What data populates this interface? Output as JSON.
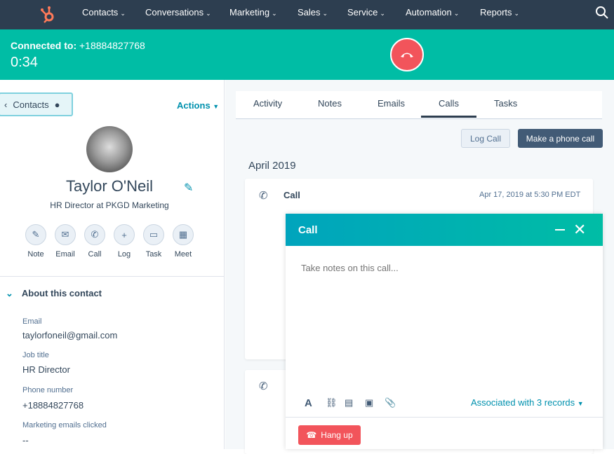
{
  "nav": {
    "items": [
      "Contacts",
      "Conversations",
      "Marketing",
      "Sales",
      "Service",
      "Automation",
      "Reports"
    ]
  },
  "callbar": {
    "connected_label": "Connected to:",
    "number": "+18884827768",
    "timer": "0:34"
  },
  "sidebar": {
    "back": "Contacts",
    "actions": "Actions",
    "name": "Taylor O'Neil",
    "subtitle": "HR Director at PKGD Marketing",
    "quick_actions": [
      "Note",
      "Email",
      "Call",
      "Log",
      "Task",
      "Meet"
    ],
    "about_title": "About this contact",
    "fields": [
      {
        "label": "Email",
        "value": "taylorfoneil@gmail.com"
      },
      {
        "label": "Job title",
        "value": "HR Director"
      },
      {
        "label": "Phone number",
        "value": "+18884827768"
      },
      {
        "label": "Marketing emails clicked",
        "value": "--"
      }
    ]
  },
  "main": {
    "tabs": [
      "Activity",
      "Notes",
      "Emails",
      "Calls",
      "Tasks"
    ],
    "active_tab": "Calls",
    "log_call": "Log Call",
    "make_call": "Make a phone call",
    "month": "April 2019",
    "card": {
      "title": "Call",
      "time": "Apr 17, 2019 at 5:30 PM EDT"
    }
  },
  "modal": {
    "title": "Call",
    "placeholder": "Take notes on this call...",
    "associated": "Associated with 3 records",
    "hang_up": "Hang up"
  },
  "colors": {
    "nav": "#2d3e50",
    "callbar": "#00bda5",
    "hangup": "#f2545b",
    "link": "#0091ae"
  }
}
